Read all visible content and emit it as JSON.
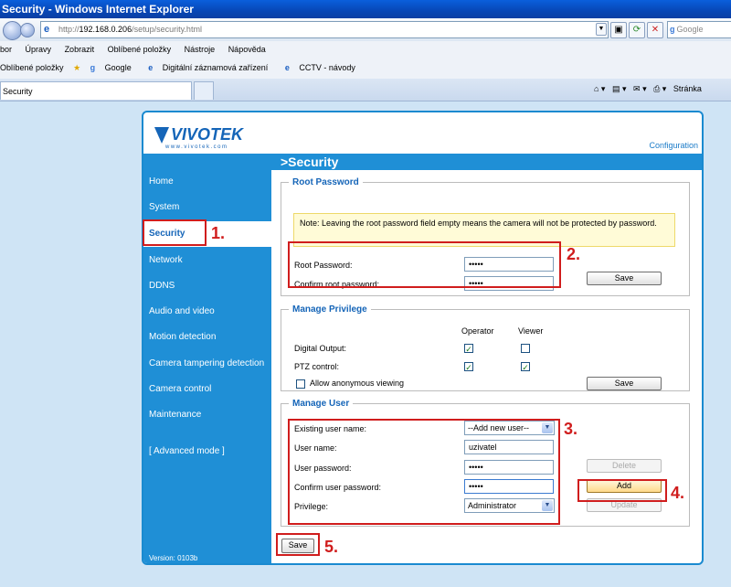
{
  "browser": {
    "window_title": "Security - Windows Internet Explorer",
    "address_scheme": "http://",
    "address_host": "192.168.0.206",
    "address_path": "/setup/security.html",
    "search_placeholder": "Google",
    "menu": [
      "bor",
      "Úpravy",
      "Zobrazit",
      "Oblíbené položky",
      "Nástroje",
      "Nápověda"
    ],
    "favorites_label": "Oblíbené položky",
    "favorites": [
      "Google",
      "Digitální záznamová zařízení",
      "CCTV - návody"
    ],
    "tab_title": "Security",
    "page_menu": "Stránka"
  },
  "page": {
    "logo_text": "VIVOTEK",
    "logo_sub": "www.vivotek.com",
    "config_link": "Configuration",
    "header": ">Security",
    "version": "Version: 0103b",
    "nav": [
      {
        "label": "Home"
      },
      {
        "label": "System"
      },
      {
        "label": "Security"
      },
      {
        "label": "Network"
      },
      {
        "label": "DDNS"
      },
      {
        "label": "Audio and video"
      },
      {
        "label": "Motion detection"
      },
      {
        "label": "Camera tampering detection"
      },
      {
        "label": "Camera control"
      },
      {
        "label": "Maintenance"
      },
      {
        "label": "[ Advanced mode ]"
      }
    ],
    "root": {
      "legend": "Root Password",
      "note": "Note: Leaving the root password field empty means the camera will not be protected by password.",
      "root_password_label": "Root Password:",
      "confirm_label": "Confirm root password:",
      "root_password_value": "•••••",
      "confirm_value": "•••••",
      "save_label": "Save"
    },
    "privilege": {
      "legend": "Manage Privilege",
      "col_operator": "Operator",
      "col_viewer": "Viewer",
      "digital_output_label": "Digital Output:",
      "ptz_label": "PTZ control:",
      "digital_output_operator": true,
      "digital_output_viewer": false,
      "ptz_operator": true,
      "ptz_viewer": true,
      "anonymous_label": "Allow anonymous viewing",
      "anonymous_checked": false,
      "save_label": "Save"
    },
    "user": {
      "legend": "Manage User",
      "existing_label": "Existing user name:",
      "existing_value": "--Add new user--",
      "username_label": "User name:",
      "username_value": "uzivatel",
      "password_label": "User password:",
      "password_value": "•••••",
      "confirm_label": "Confirm user password:",
      "confirm_value": "•••••",
      "privilege_label": "Privilege:",
      "privilege_value": "Administrator",
      "delete_label": "Delete",
      "add_label": "Add",
      "update_label": "Update"
    },
    "save_label": "Save"
  },
  "annotations": [
    "1.",
    "2.",
    "3.",
    "4.",
    "5."
  ],
  "colors": {
    "accent": "#1f8fd6",
    "annotation_red": "#d01d1d"
  }
}
